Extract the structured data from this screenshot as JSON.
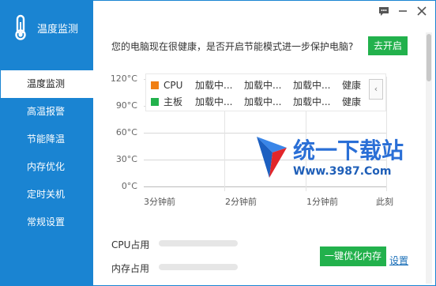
{
  "app": {
    "title": "温度监测"
  },
  "sidebar": {
    "items": [
      {
        "label": "温度监测",
        "active": true
      },
      {
        "label": "高温报警"
      },
      {
        "label": "节能降温"
      },
      {
        "label": "内存优化"
      },
      {
        "label": "定时关机"
      },
      {
        "label": "常规设置"
      }
    ]
  },
  "header": {
    "question": "您的电脑现在很健康，是否开启节能模式进一步保护电脑?",
    "enable_label": "去开启"
  },
  "chart": {
    "yticks": [
      "120°C",
      "90°C",
      "60°C",
      "30°C",
      "0°C"
    ],
    "xticks": [
      "3分钟前",
      "2分钟前",
      "1分钟前",
      "此刻"
    ],
    "legend": [
      {
        "name": "CPU",
        "color": "#f07f13",
        "values": [
          "加载中...",
          "加载中...",
          "加载中...",
          "健康"
        ]
      },
      {
        "name": "主板",
        "color": "#22b14c",
        "values": [
          "加载中...",
          "加载中...",
          "加载中...",
          "健康"
        ]
      }
    ],
    "collapse_icon": "‹"
  },
  "usage": {
    "cpu_label": "CPU占用",
    "mem_label": "内存占用"
  },
  "actions": {
    "optimize_label": "一键优化内存",
    "settings_label": "设置"
  },
  "watermark": {
    "text": "统一下载站",
    "url": "Www.3987.Com"
  }
}
